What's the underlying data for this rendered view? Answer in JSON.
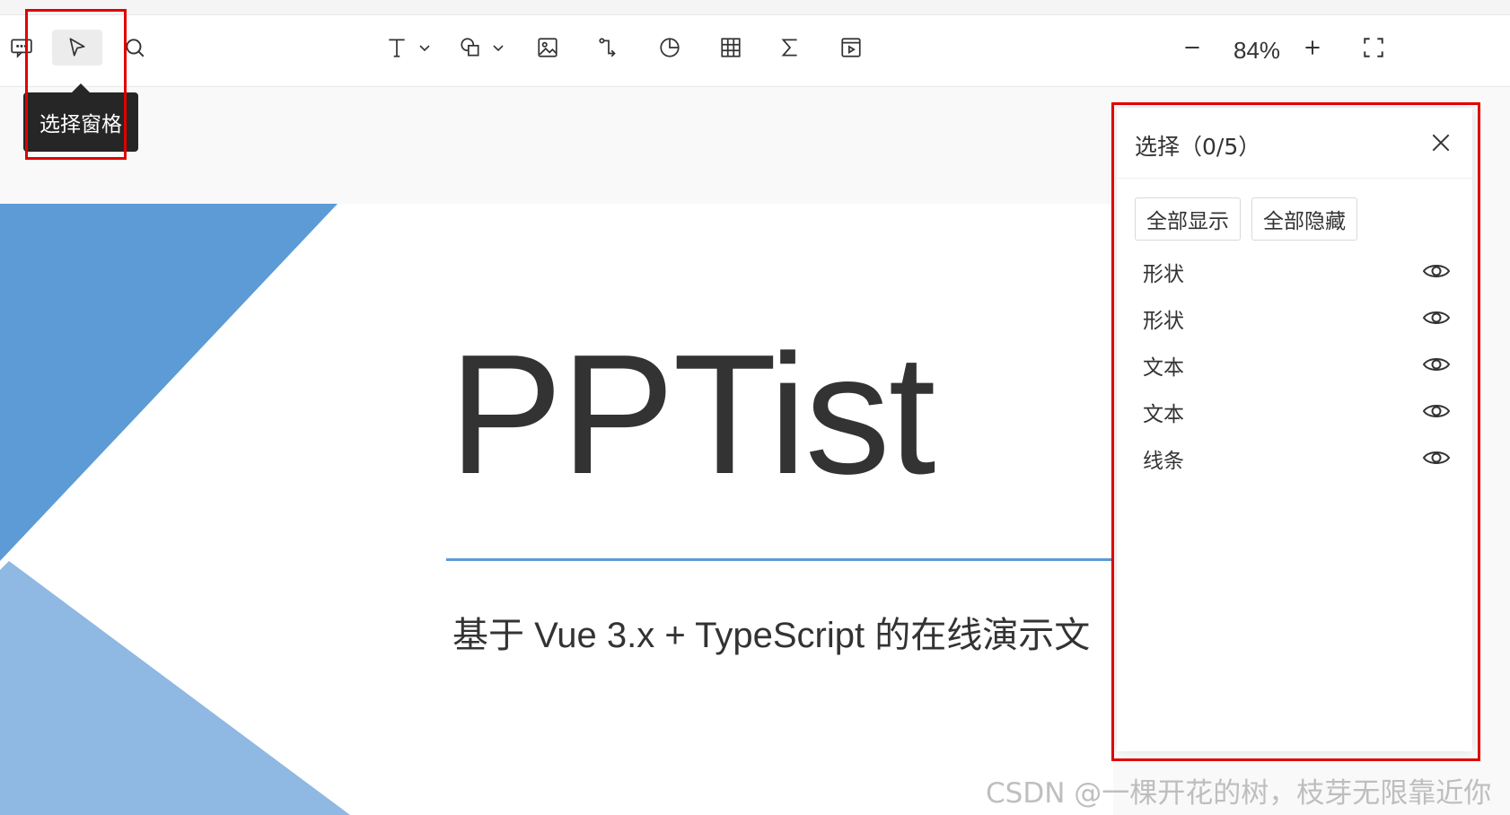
{
  "toolbar": {
    "tooltip": "选择窗格",
    "zoom": "84%"
  },
  "slide": {
    "title": "PPTist",
    "subtitle": "基于 Vue 3.x + TypeScript 的在线演示文"
  },
  "selection_panel": {
    "title": "选择（0/5）",
    "show_all": "全部显示",
    "hide_all": "全部隐藏",
    "items": [
      {
        "label": "形状"
      },
      {
        "label": "形状"
      },
      {
        "label": "文本"
      },
      {
        "label": "文本"
      },
      {
        "label": "线条"
      }
    ]
  },
  "watermark": "CSDN @一棵开花的树，枝芽无限靠近你",
  "colors": {
    "accent_blue": "#5c9bd5",
    "light_blue": "#8fb8e2",
    "highlight_red": "#e00000"
  }
}
